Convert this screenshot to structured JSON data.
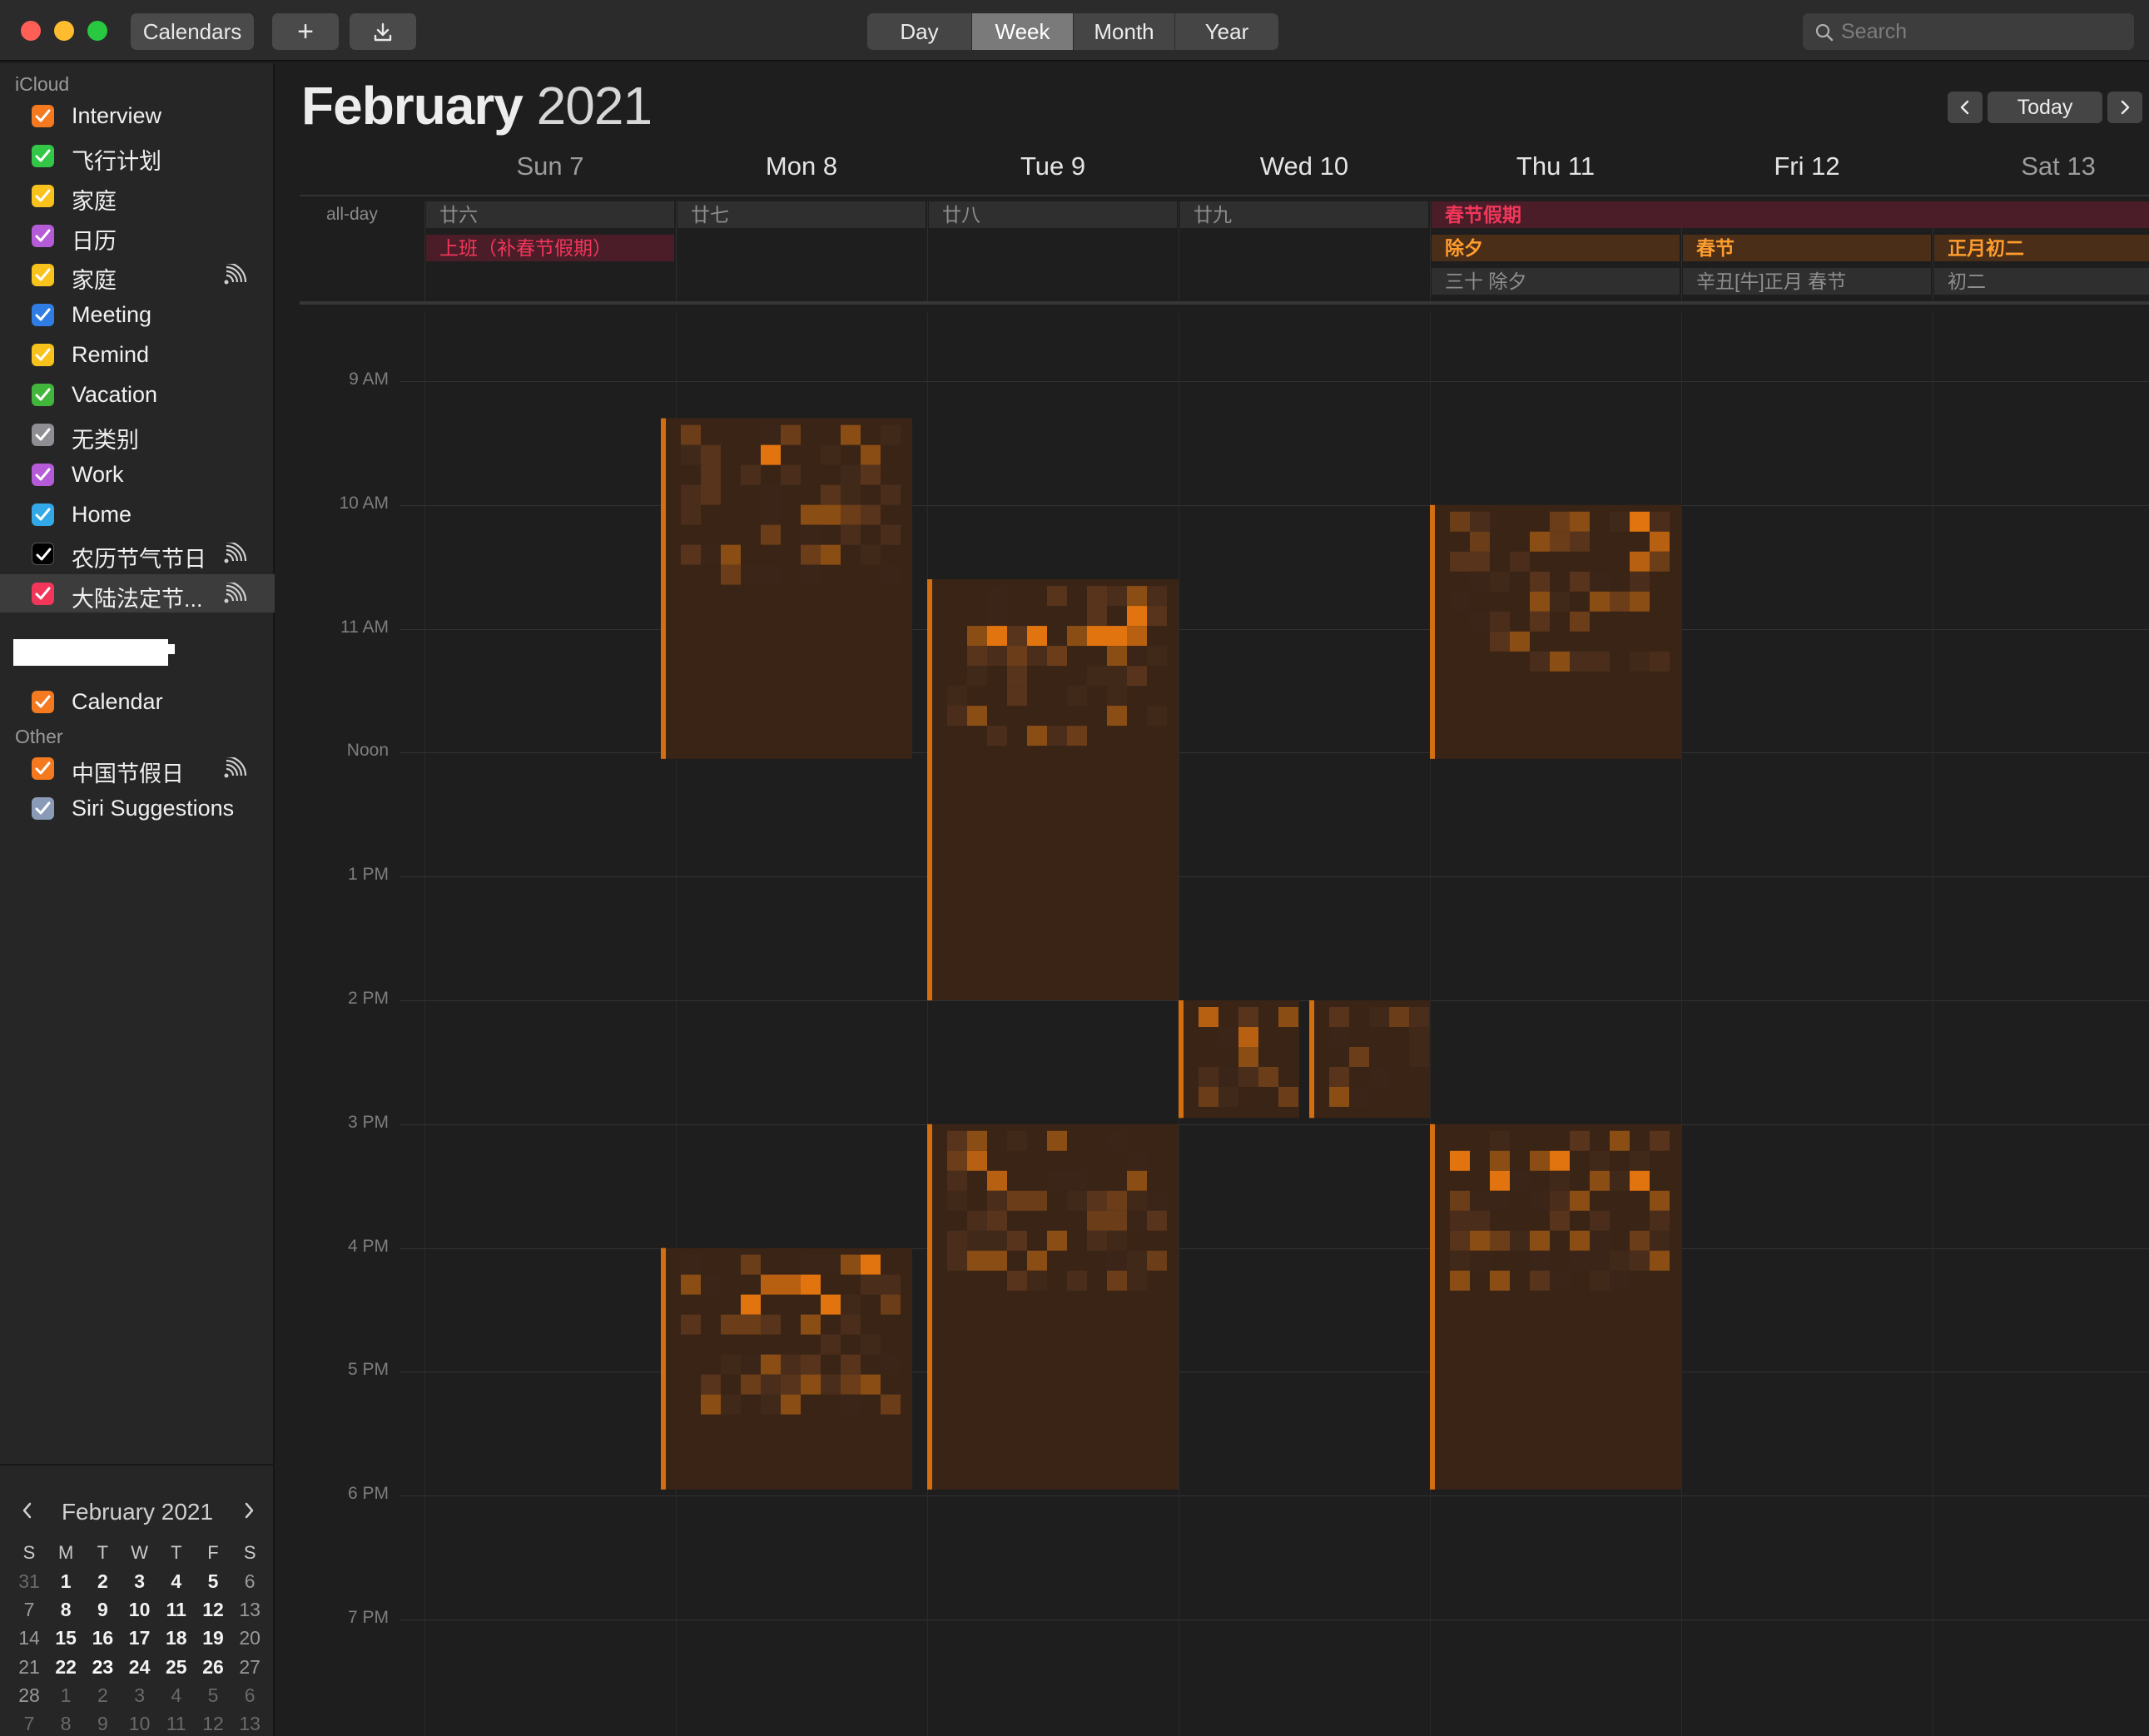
{
  "toolbar": {
    "calendars_label": "Calendars",
    "add_label": "+",
    "views": [
      "Day",
      "Week",
      "Month",
      "Year"
    ],
    "active_view": "Week",
    "search_placeholder": "Search"
  },
  "sidebar": {
    "icloud_label": "iCloud",
    "icloud_calendars": [
      {
        "label": "Interview",
        "color": "#f4791f",
        "subscribed": false
      },
      {
        "label": "飞行计划",
        "color": "#33c748",
        "subscribed": false
      },
      {
        "label": "家庭",
        "color": "#f8c21c",
        "subscribed": false
      },
      {
        "label": "日历",
        "color": "#b55bd7",
        "subscribed": false
      },
      {
        "label": "家庭",
        "color": "#f8c21c",
        "subscribed": true
      },
      {
        "label": "Meeting",
        "color": "#2f7de4",
        "subscribed": false
      },
      {
        "label": "Remind",
        "color": "#f8c21c",
        "subscribed": false
      },
      {
        "label": "Vacation",
        "color": "#42b53c",
        "subscribed": false
      },
      {
        "label": "无类别",
        "color": "#8e8e93",
        "subscribed": false
      },
      {
        "label": "Work",
        "color": "#b55bd7",
        "subscribed": false
      },
      {
        "label": "Home",
        "color": "#33a8e8",
        "subscribed": false
      },
      {
        "label": "农历节气节日",
        "color": "#000000",
        "subscribed": true
      },
      {
        "label": "大陆法定节...",
        "color": "#f2365a",
        "subscribed": true
      }
    ],
    "account_calendars": [
      {
        "label": "Calendar",
        "color": "#f4791f",
        "subscribed": false
      }
    ],
    "other_label": "Other",
    "other_calendars": [
      {
        "label": "中国节假日",
        "color": "#f4791f",
        "subscribed": true
      },
      {
        "label": "Siri Suggestions",
        "color": "#8a9bb8",
        "subscribed": false
      }
    ]
  },
  "mini_calendar": {
    "title": "February 2021",
    "weekdays": [
      "S",
      "M",
      "T",
      "W",
      "T",
      "F",
      "S"
    ],
    "weeks": [
      [
        "31",
        "1",
        "2",
        "3",
        "4",
        "5",
        "6"
      ],
      [
        "7",
        "8",
        "9",
        "10",
        "11",
        "12",
        "13"
      ],
      [
        "14",
        "15",
        "16",
        "17",
        "18",
        "19",
        "20"
      ],
      [
        "21",
        "22",
        "23",
        "24",
        "25",
        "26",
        "27"
      ],
      [
        "28",
        "1",
        "2",
        "3",
        "4",
        "5",
        "6"
      ],
      [
        "7",
        "8",
        "9",
        "10",
        "11",
        "12",
        "13"
      ]
    ],
    "today": "23"
  },
  "main": {
    "month": "February",
    "year": "2021",
    "today_label": "Today",
    "days": [
      {
        "label": "Sun 7",
        "weekend": true
      },
      {
        "label": "Mon 8",
        "weekend": false
      },
      {
        "label": "Tue 9",
        "weekend": false
      },
      {
        "label": "Wed 10",
        "weekend": false
      },
      {
        "label": "Thu 11",
        "weekend": false
      },
      {
        "label": "Fri 12",
        "weekend": false
      },
      {
        "label": "Sat 13",
        "weekend": true
      }
    ],
    "allday_label": "all-day",
    "allday_events": [
      {
        "text": "廿六",
        "day": 0,
        "span": 1,
        "row": 0,
        "style": "gray"
      },
      {
        "text": "廿七",
        "day": 1,
        "span": 1,
        "row": 0,
        "style": "gray"
      },
      {
        "text": "廿八",
        "day": 2,
        "span": 1,
        "row": 0,
        "style": "gray"
      },
      {
        "text": "廿九",
        "day": 3,
        "span": 1,
        "row": 0,
        "style": "gray"
      },
      {
        "text": "春节假期",
        "day": 4,
        "span": 3,
        "row": 0,
        "style": "red-bold"
      },
      {
        "text": "上班（补春节假期）",
        "day": 0,
        "span": 1,
        "row": 1,
        "style": "red"
      },
      {
        "text": "除夕",
        "day": 4,
        "span": 1,
        "row": 1,
        "style": "orange"
      },
      {
        "text": "春节",
        "day": 5,
        "span": 1,
        "row": 1,
        "style": "orange"
      },
      {
        "text": "正月初二",
        "day": 6,
        "span": 1,
        "row": 1,
        "style": "orange"
      },
      {
        "text": "三十 除夕",
        "day": 4,
        "span": 1,
        "row": 2,
        "style": "gray"
      },
      {
        "text": "辛丑[牛]正月 春节",
        "day": 5,
        "span": 1,
        "row": 2,
        "style": "gray"
      },
      {
        "text": "初二",
        "day": 6,
        "span": 1,
        "row": 2,
        "style": "gray"
      }
    ],
    "hours": [
      "9 AM",
      "10 AM",
      "11 AM",
      "Noon",
      "1 PM",
      "2 PM",
      "3 PM",
      "4 PM",
      "5 PM",
      "6 PM",
      "7 PM"
    ],
    "redacted_events": [
      {
        "col": 1,
        "start_h": 9.3,
        "end_h": 12.05
      },
      {
        "col": 2,
        "start_h": 10.6,
        "end_h": 14.0
      },
      {
        "col": 4,
        "start_h": 10.0,
        "end_h": 12.05
      },
      {
        "col": 3,
        "start_h": 14.0,
        "end_h": 14.95,
        "split": true
      },
      {
        "col": 1,
        "start_h": 16.0,
        "end_h": 17.95
      },
      {
        "col": 2,
        "start_h": 15.0,
        "end_h": 17.95
      },
      {
        "col": 4,
        "start_h": 15.0,
        "end_h": 17.95
      }
    ],
    "accent_orange": "#f07c10",
    "event_brown": "#3a2416"
  }
}
